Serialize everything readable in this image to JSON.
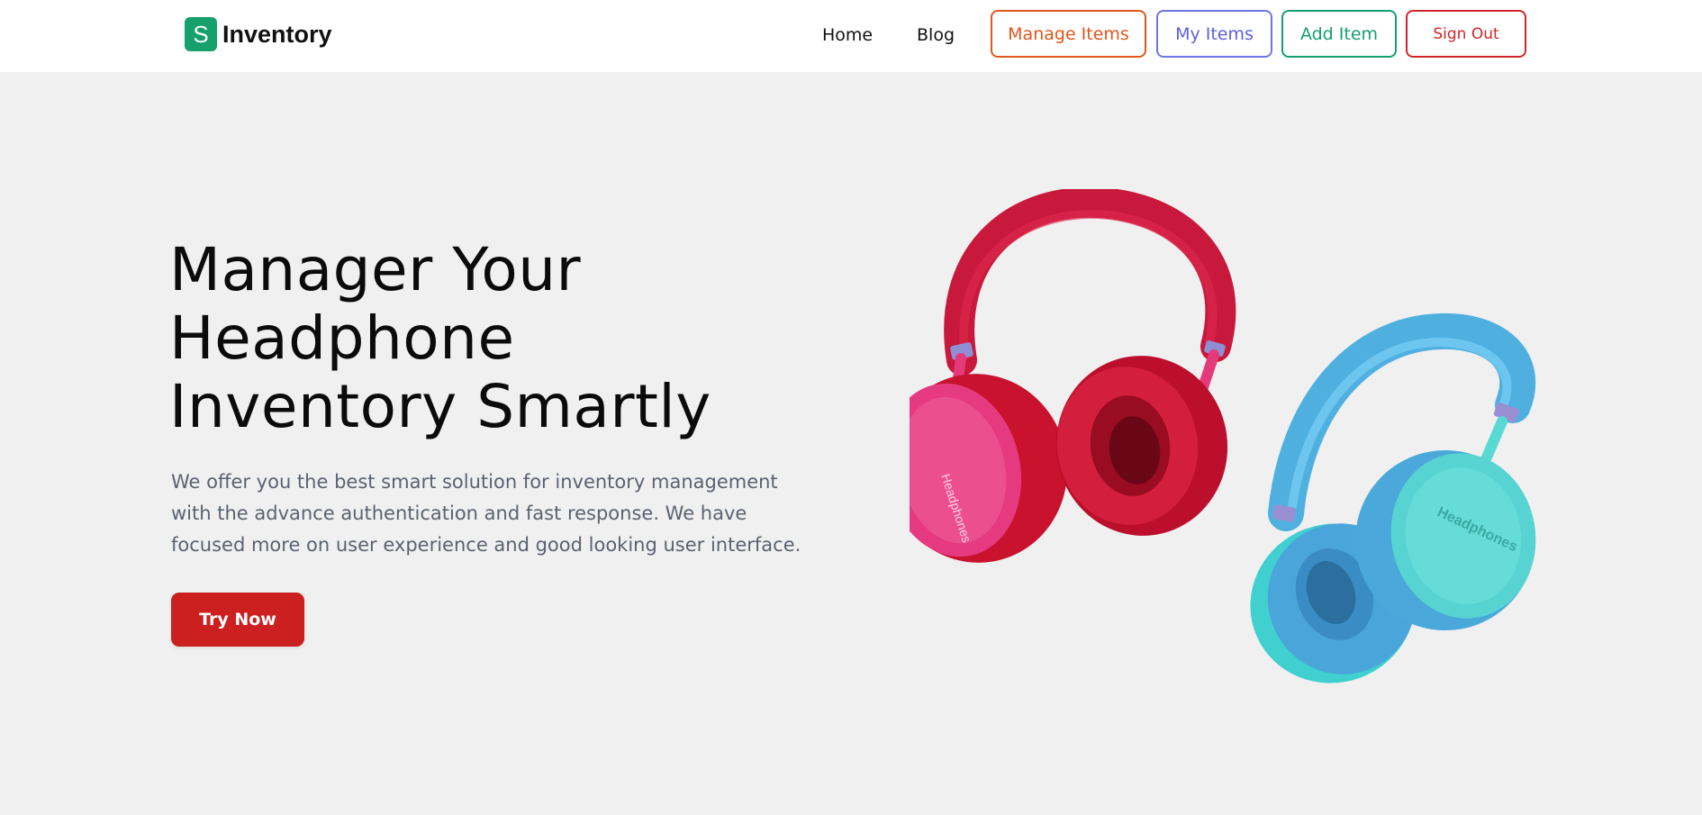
{
  "navbar": {
    "brand": {
      "logo_letter": "S",
      "name": "Inventory",
      "logo_color": "#16a06c"
    },
    "links": [
      {
        "label": "Home"
      },
      {
        "label": "Blog"
      }
    ],
    "buttons": [
      {
        "label": "Manage Items",
        "color": "#e0561b"
      },
      {
        "label": "My Items",
        "color": "#5b5fe0"
      },
      {
        "label": "Add Item",
        "color": "#16a06c"
      },
      {
        "label": "Sign Out",
        "color": "#d0262a"
      }
    ]
  },
  "hero": {
    "title_lines": [
      "Manager Your",
      "Headphone",
      "Inventory Smartly"
    ],
    "description_lines": [
      "We offer you the best smart solution for inventory management",
      "with the advance authentication and fast response. We have",
      "focused more on user experience and good looking user interface."
    ],
    "cta_label": "Try Now",
    "cta_color": "#cc1f1f"
  },
  "image": {
    "alt": "Two headphones, red and blue",
    "red_headphone_label": "Headphones",
    "blue_headphone_label": "Headphones"
  },
  "colors": {
    "page_background": "#f0f0f0",
    "navbar_background": "#ffffff",
    "title_text": "#0b0b0b",
    "body_text": "#5b6270"
  }
}
